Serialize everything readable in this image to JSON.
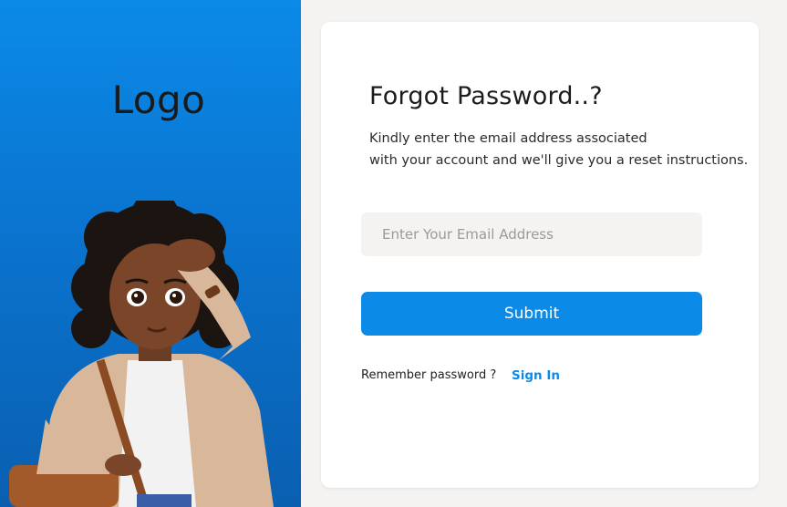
{
  "brand": {
    "logo_text": "Logo"
  },
  "illustration": {
    "name": "girl-illustration"
  },
  "form": {
    "title": "Forgot Password..?",
    "description_line1": "Kindly enter the email address associated",
    "description_line2": "with your account and we'll give you a reset instructions.",
    "email_placeholder": "Enter Your Email Address",
    "email_value": "",
    "submit_label": "Submit",
    "remember_text": "Remember password ?",
    "signin_label": "Sign In"
  },
  "colors": {
    "primary": "#0b8ae8",
    "panel_gradient_top": "#0b8ae8",
    "panel_gradient_bottom": "#0a5fb0",
    "page_background": "#f5f3f1",
    "card_background": "#ffffff"
  }
}
